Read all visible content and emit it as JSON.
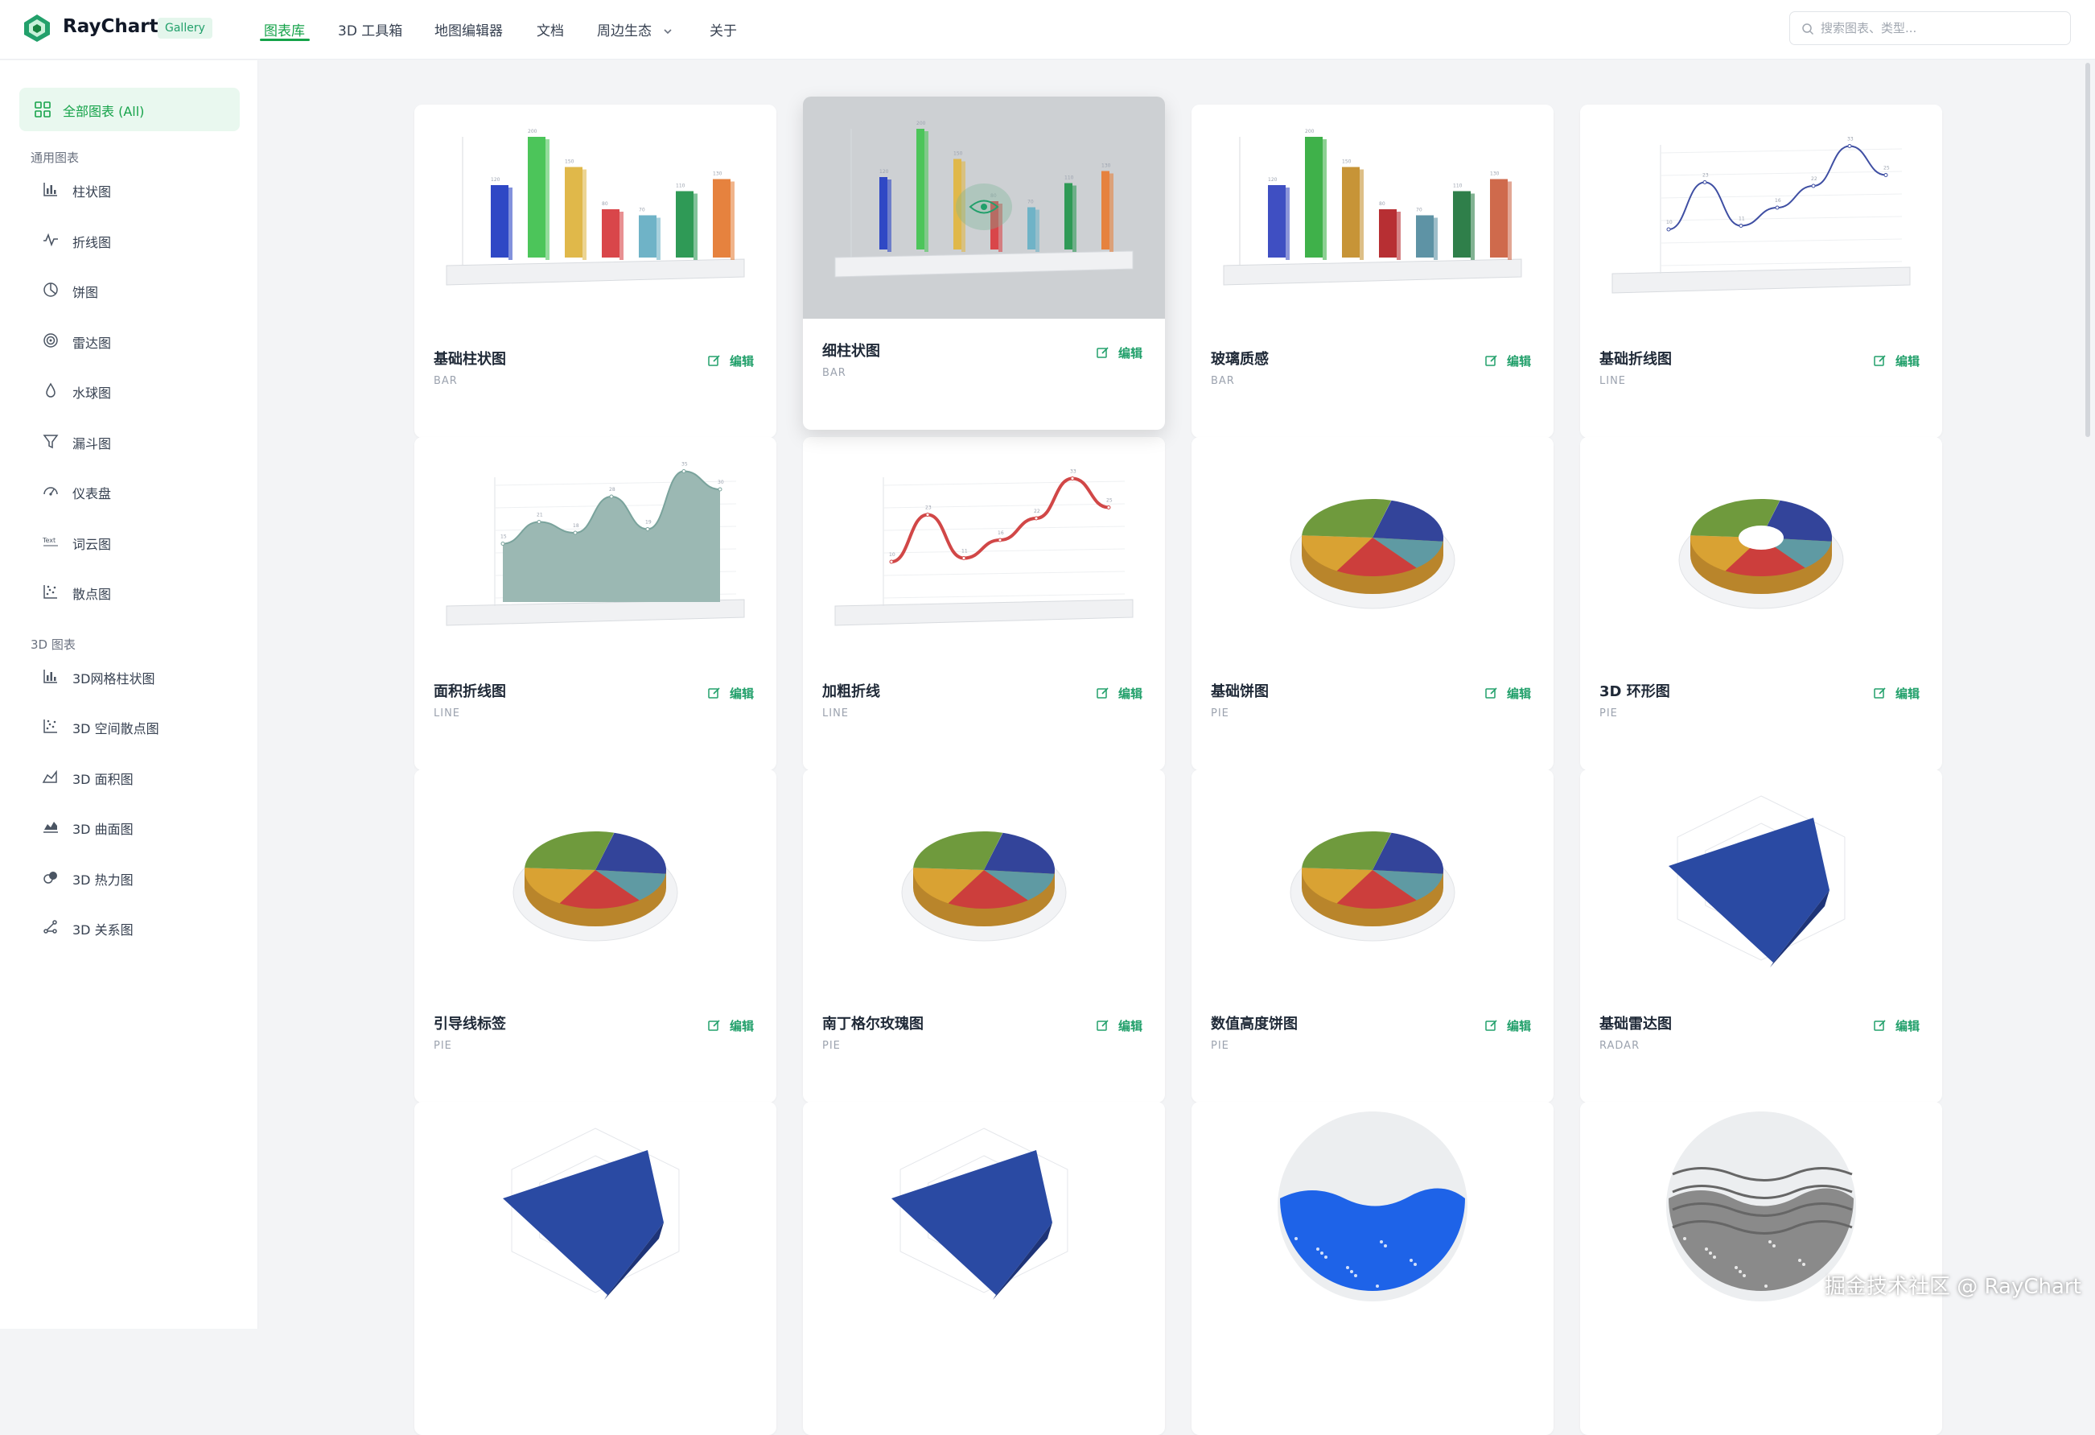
{
  "app": {
    "name": "RayChart",
    "tag": "Gallery"
  },
  "nav": [
    "图表库",
    "3D 工具箱",
    "地图编辑器",
    "文档",
    "周边生态",
    "关于"
  ],
  "search": {
    "placeholder": "搜索图表、类型..."
  },
  "sidebar": {
    "all_label": "全部图表 (All)",
    "groups": [
      {
        "title": "通用图表",
        "items": [
          {
            "label": "柱状图",
            "icon": "bar-chart-icon"
          },
          {
            "label": "折线图",
            "icon": "line-chart-icon"
          },
          {
            "label": "饼图",
            "icon": "pie-chart-icon"
          },
          {
            "label": "雷达图",
            "icon": "radar-chart-icon"
          },
          {
            "label": "水球图",
            "icon": "water-drop-icon"
          },
          {
            "label": "漏斗图",
            "icon": "funnel-icon"
          },
          {
            "label": "仪表盘",
            "icon": "gauge-icon"
          },
          {
            "label": "词云图",
            "icon": "wordcloud-icon"
          },
          {
            "label": "散点图",
            "icon": "scatter-icon"
          }
        ]
      },
      {
        "title": "3D 图表",
        "items": [
          {
            "label": "3D网格柱状图",
            "icon": "bar-chart-icon"
          },
          {
            "label": "3D 空间散点图",
            "icon": "scatter-icon"
          },
          {
            "label": "3D 面积图",
            "icon": "area-chart-icon"
          },
          {
            "label": "3D 曲面图",
            "icon": "surface-chart-icon"
          },
          {
            "label": "3D 热力图",
            "icon": "heatmap-icon"
          },
          {
            "label": "3D 关系图",
            "icon": "graph-icon"
          }
        ]
      }
    ]
  },
  "edit_label": "编辑",
  "cards": [
    {
      "title": "基础柱状图",
      "type": "BAR"
    },
    {
      "title": "细柱状图",
      "type": "BAR"
    },
    {
      "title": "玻璃质感",
      "type": "BAR"
    },
    {
      "title": "基础折线图",
      "type": "LINE"
    },
    {
      "title": "面积折线图",
      "type": "LINE"
    },
    {
      "title": "加粗折线",
      "type": "LINE"
    },
    {
      "title": "基础饼图",
      "type": "PIE"
    },
    {
      "title": "3D 环形图",
      "type": "PIE"
    },
    {
      "title": "引导线标签",
      "type": "PIE"
    },
    {
      "title": "南丁格尔玫瑰图",
      "type": "PIE"
    },
    {
      "title": "数值高度饼图",
      "type": "PIE"
    },
    {
      "title": "基础雷达图",
      "type": "RADAR"
    },
    {
      "title": "",
      "type": ""
    },
    {
      "title": "",
      "type": ""
    },
    {
      "title": "",
      "type": ""
    },
    {
      "title": "",
      "type": ""
    }
  ],
  "thumbnails": {
    "bar_values": [
      120,
      200,
      150,
      80,
      70,
      110,
      130
    ],
    "bar_colors": [
      "#2f48c5",
      "#4cc55a",
      "#e0b84a",
      "#d9464a",
      "#6fb3c7",
      "#2f9a56",
      "#e6823e"
    ],
    "glass_colors": [
      "#3f4fc2",
      "#3fb14a",
      "#c79437",
      "#b72f33",
      "#5e93a5",
      "#2f7f4a",
      "#cf6a4c"
    ],
    "line_values": [
      10,
      23,
      11,
      16,
      22,
      33,
      25
    ],
    "area_values": [
      15,
      21,
      18,
      28,
      19,
      35,
      30
    ],
    "pie_colors": [
      "#33449a",
      "#5f9aa3",
      "#cc3e3c",
      "#d9a233",
      "#6f9a3d"
    ],
    "radar_color": "#2a4aa3",
    "water_color": "#1e63e8",
    "surface_color": "#8a8a8a"
  },
  "watermark": "掘金技术社区 @ RayChart",
  "colors": {
    "accent": "#16a34a"
  }
}
